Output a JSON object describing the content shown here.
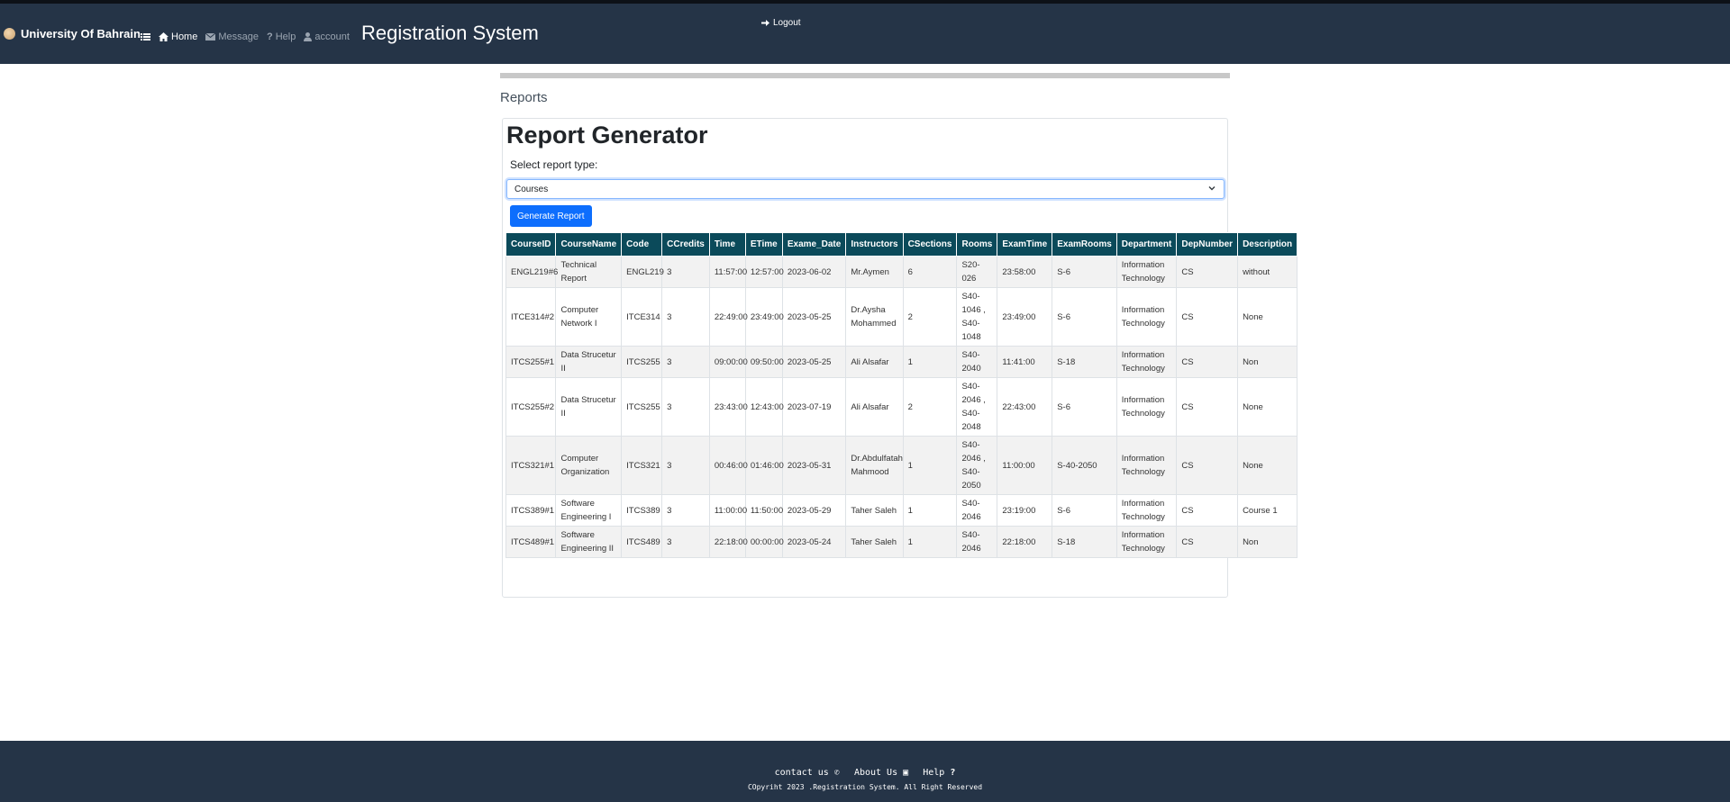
{
  "navbar": {
    "brand": "University Of Bahrain",
    "items": [
      {
        "label": "Home",
        "icon": "home-icon"
      },
      {
        "label": "Message",
        "icon": "envelope-icon"
      },
      {
        "label": "Help",
        "icon": "question-icon"
      },
      {
        "label": "account",
        "icon": "user-icon"
      }
    ],
    "menu_icon": "list-icon",
    "app_title": "Registration System",
    "logout": "Logout"
  },
  "page": {
    "section_title": "Reports",
    "heading": "Report Generator",
    "select_label": "Select report type:",
    "select_value": "Courses",
    "generate_button": "Generate Report"
  },
  "table": {
    "headers": [
      "CourseID",
      "CourseName",
      "Code",
      "CCredits",
      "Time",
      "ETime",
      "Exame_Date",
      "Instructors",
      "CSections",
      "Rooms",
      "ExamTime",
      "ExamRooms",
      "Department",
      "DepNumber",
      "Description"
    ],
    "rows": [
      [
        "ENGL219#6",
        "Technical Report",
        "ENGL219",
        "3",
        "11:57:00",
        "12:57:00",
        "2023-06-02",
        "Mr.Aymen",
        "6",
        "S20-026",
        "23:58:00",
        "S-6",
        "Information Technology",
        "CS",
        "without"
      ],
      [
        "ITCE314#2",
        "Computer Network I",
        "ITCE314",
        "3",
        "22:49:00",
        "23:49:00",
        "2023-05-25",
        "Dr.Aysha Mohammed",
        "2",
        "S40-1046 , S40-1048",
        "23:49:00",
        "S-6",
        "Information Technology",
        "CS",
        "None"
      ],
      [
        "ITCS255#1",
        "Data Strucetur II",
        "ITCS255",
        "3",
        "09:00:00",
        "09:50:00",
        "2023-05-25",
        "Ali Alsafar",
        "1",
        "S40-2040",
        "11:41:00",
        "S-18",
        "Information Technology",
        "CS",
        "Non"
      ],
      [
        "ITCS255#2",
        "Data Strucetur II",
        "ITCS255",
        "3",
        "23:43:00",
        "12:43:00",
        "2023-07-19",
        "Ali Alsafar",
        "2",
        "S40-2046 , S40-2048",
        "22:43:00",
        "S-6",
        "Information Technology",
        "CS",
        "None"
      ],
      [
        "ITCS321#1",
        "Computer Organization",
        "ITCS321",
        "3",
        "00:46:00",
        "01:46:00",
        "2023-05-31",
        "Dr.Abdulfatah Mahmood",
        "1",
        "S40-2046 , S40-2050",
        "11:00:00",
        "S-40-2050",
        "Information Technology",
        "CS",
        "None"
      ],
      [
        "ITCS389#1",
        "Software Engineering I",
        "ITCS389",
        "3",
        "11:00:00",
        "11:50:00",
        "2023-05-29",
        "Taher Saleh",
        "1",
        "S40-2046",
        "23:19:00",
        "S-6",
        "Information Technology",
        "CS",
        "Course 1"
      ],
      [
        "ITCS489#1",
        "Software Engineering II",
        "ITCS489",
        "3",
        "22:18:00",
        "00:00:00",
        "2023-05-24",
        "Taher Saleh",
        "1",
        "S40-2046",
        "22:18:00",
        "S-18",
        "Information Technology",
        "CS",
        "Non"
      ]
    ]
  },
  "footer": {
    "contact": "contact us",
    "about": "About Us",
    "help": "Help",
    "copyright": "COpyriht 2023 .Registration System. All Right Reserved"
  },
  "colors": {
    "navbar_bg": "#253447",
    "table_header_bg": "#0b4a5a",
    "button_primary": "#0d6efd"
  }
}
